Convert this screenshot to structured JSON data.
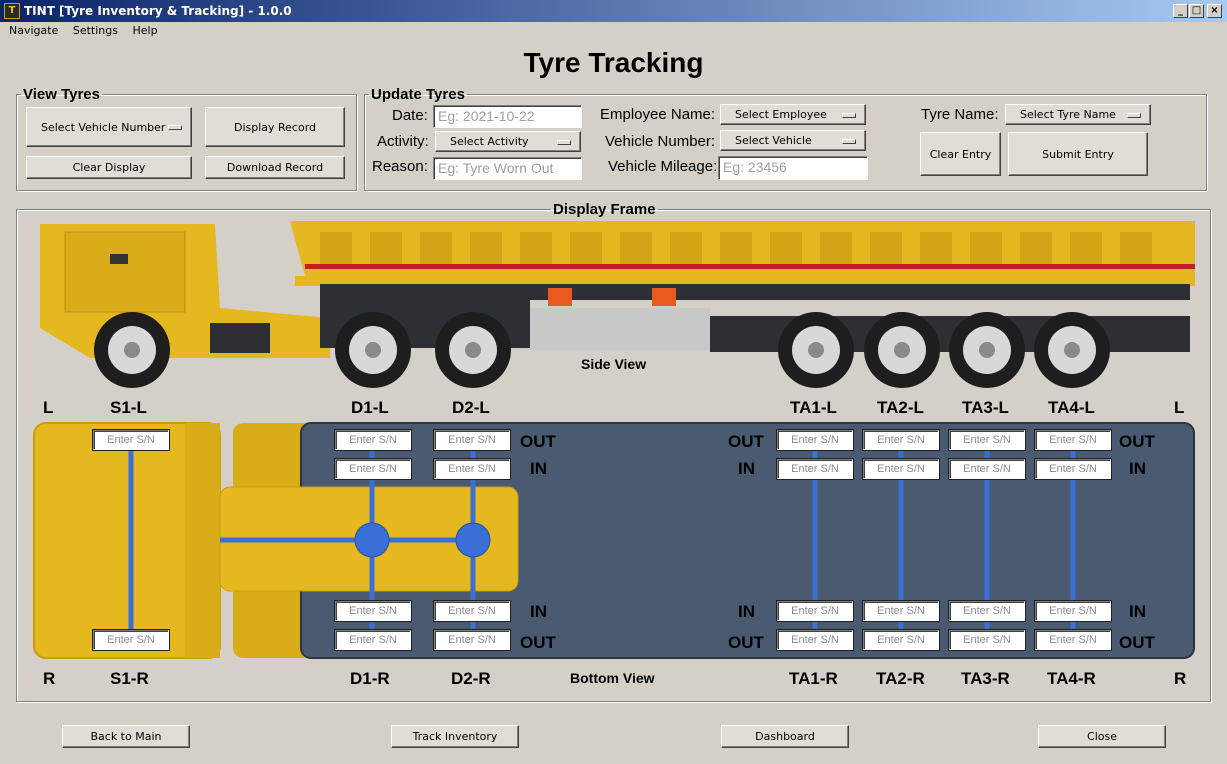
{
  "window": {
    "title": "TINT [Tyre Inventory & Tracking] - 1.0.0",
    "minimize": "_",
    "maximize": "□",
    "close": "×"
  },
  "menu": [
    "Navigate",
    "Settings",
    "Help"
  ],
  "page_title": "Tyre Tracking",
  "view_tyres": {
    "legend": "View Tyres",
    "vehicle_select": "Select Vehicle Number",
    "display_record": "Display Record",
    "clear_display": "Clear Display",
    "download_record": "Download Record"
  },
  "update_tyres": {
    "legend": "Update Tyres",
    "date_label": "Date:",
    "date_placeholder": "Eg: 2021-10-22",
    "activity_label": "Activity:",
    "activity_select": "Select Activity",
    "reason_label": "Reason:",
    "reason_placeholder": "Eg: Tyre Worn Out",
    "employee_label": "Employee Name:",
    "employee_select": "Select Employee",
    "vehicle_label": "Vehicle Number:",
    "vehicle_select": "Select Vehicle",
    "mileage_label": "Vehicle Mileage:",
    "mileage_placeholder": "Eg: 23456",
    "tyre_name_label": "Tyre Name:",
    "tyre_name_select": "Select Tyre Name",
    "clear_entry": "Clear Entry",
    "submit_entry": "Submit Entry"
  },
  "display_frame": {
    "legend": "Display Frame",
    "side_view": "Side View",
    "bottom_view": "Bottom View",
    "left": "L",
    "right": "R",
    "out": "OUT",
    "in": "IN",
    "sn_placeholder": "Enter S/N",
    "top_labels": [
      "S1-L",
      "D1-L",
      "D2-L",
      "TA1-L",
      "TA2-L",
      "TA3-L",
      "TA4-L"
    ],
    "bottom_labels": [
      "S1-R",
      "D1-R",
      "D2-R",
      "TA1-R",
      "TA2-R",
      "TA3-R",
      "TA4-R"
    ]
  },
  "footer": {
    "back": "Back to Main",
    "track": "Track Inventory",
    "dashboard": "Dashboard",
    "close": "Close"
  },
  "colors": {
    "truck_yellow": "#e6b820",
    "trailer_blue": "#4a5a70",
    "axle_blue": "#3a6fd6"
  }
}
